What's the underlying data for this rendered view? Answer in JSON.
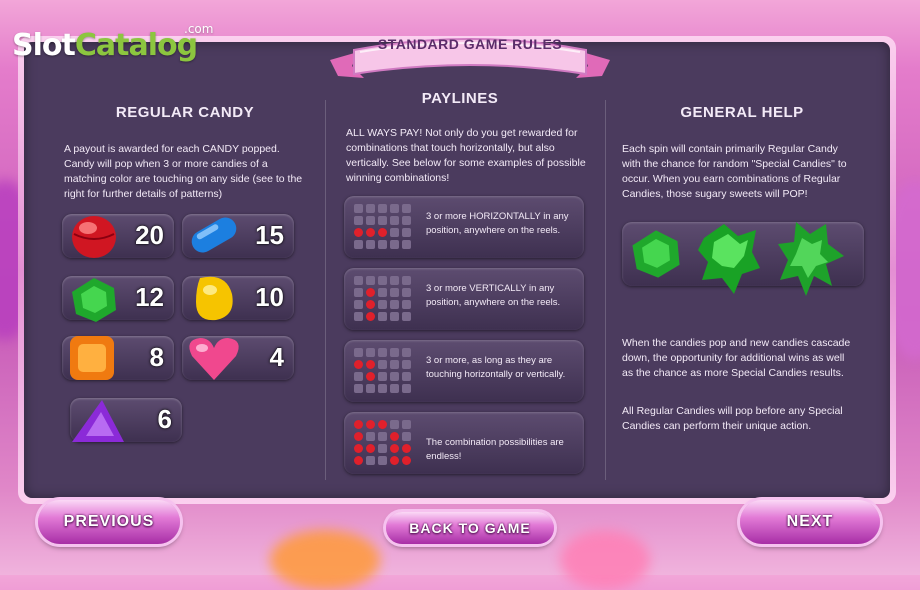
{
  "logo": {
    "text_a": "Slot",
    "text_b": "Catalog",
    "com": ".com"
  },
  "banner": {
    "title": "STANDARD GAME RULES"
  },
  "regular_candy": {
    "title": "REGULAR CANDY",
    "description": "A payout is awarded for each CANDY popped. Candy will pop when 3 or more candies of a matching color are touching on any side (see to the right for further details of patterns)",
    "payouts": [
      {
        "candy": "red-round-candy-icon",
        "value": "20"
      },
      {
        "candy": "blue-capsule-candy-icon",
        "value": "15"
      },
      {
        "candy": "green-hexagon-candy-icon",
        "value": "12"
      },
      {
        "candy": "yellow-drop-candy-icon",
        "value": "10"
      },
      {
        "candy": "orange-square-candy-icon",
        "value": "8"
      },
      {
        "candy": "pink-heart-candy-icon",
        "value": "4"
      },
      {
        "candy": "purple-triangle-candy-icon",
        "value": "6"
      }
    ]
  },
  "paylines": {
    "title": "PAYLINES",
    "description": "ALL WAYS PAY! Not only do you get rewarded for combinations that touch horizontally, but also vertically. See below for some examples of possible winning combinations!",
    "rows": [
      {
        "text": "3 or more HORIZONTALLY in any position, anywhere on the reels."
      },
      {
        "text": "3 or more VERTICALLY in any position, anywhere on the reels."
      },
      {
        "text": "3 or more, as long as they are touching horizontally or vertically."
      },
      {
        "text": "The combination possibilities are endless!"
      }
    ]
  },
  "general_help": {
    "title": "GENERAL HELP",
    "description": "Each spin will contain primarily Regular Candy with the chance for random \"Special Candies\" to occur. When you earn combinations of Regular Candies, those sugary sweets will POP!",
    "cascade_text": "When the candies pop and new candies cascade down, the opportunity for additional wins as well as the chance as more Special Candies results.",
    "order_text": "All Regular Candies will pop before any Special Candies can perform their unique action."
  },
  "buttons": {
    "previous": "PREVIOUS",
    "back": "BACK TO GAME",
    "next": "NEXT"
  },
  "colors": {
    "panel": "#4b3b5e",
    "accent": "#e27ad6",
    "red_dot": "#e0202b"
  }
}
